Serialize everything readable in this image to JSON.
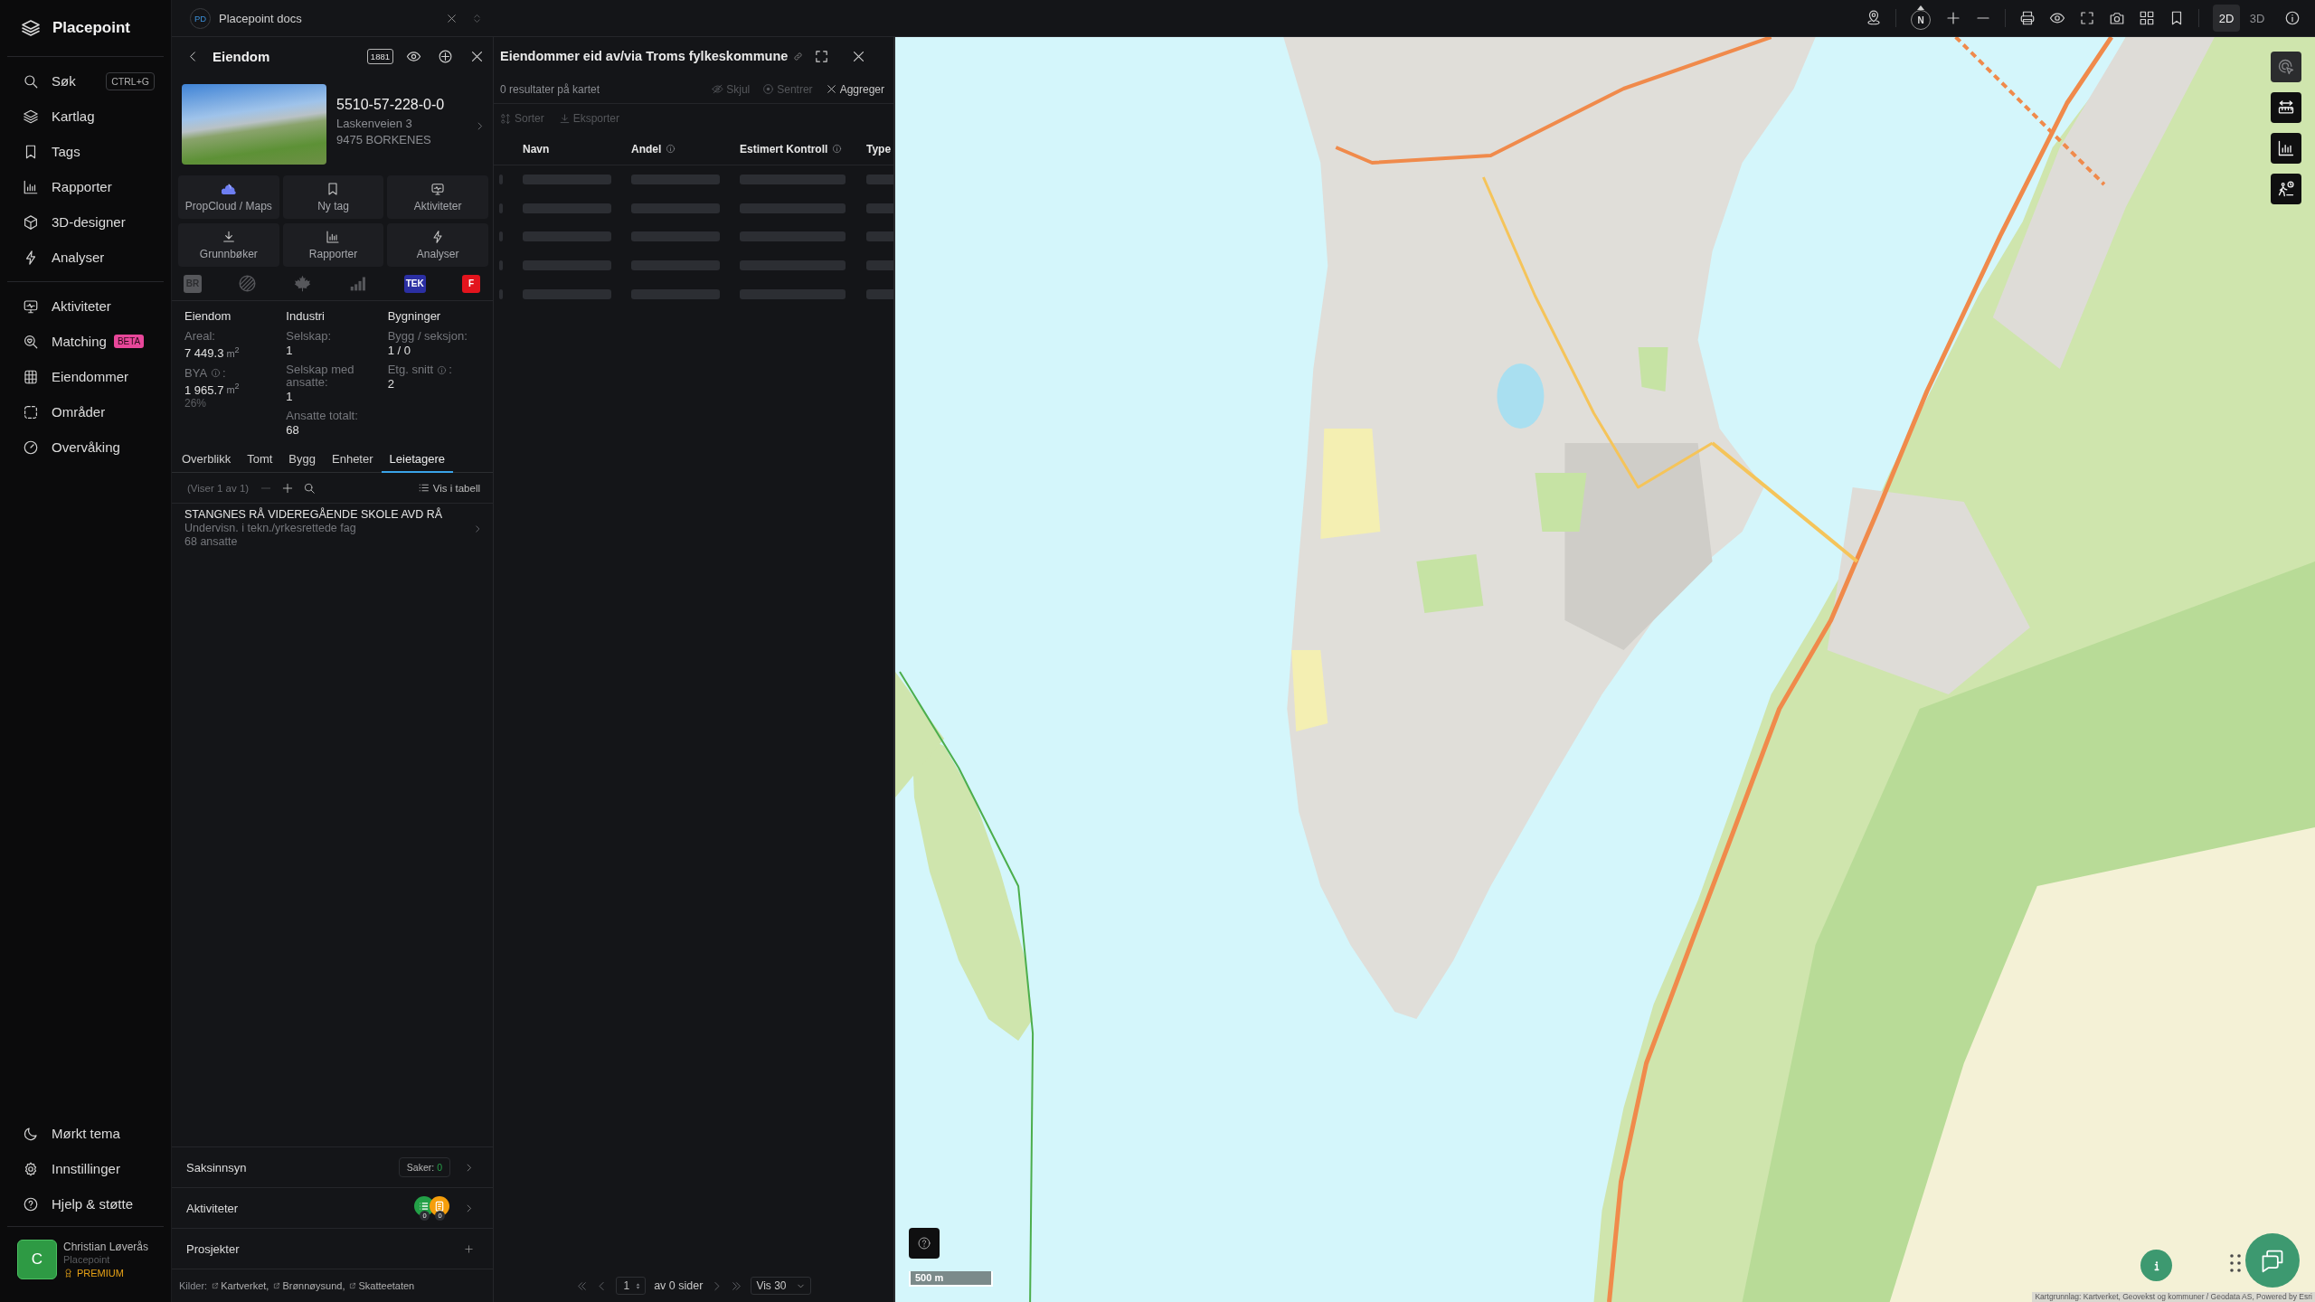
{
  "sidebar": {
    "app_name": "Placepoint",
    "nav_groups": [
      {
        "items": [
          {
            "label": "Søk",
            "shortcut": "CTRL+G"
          },
          {
            "label": "Kartlag"
          },
          {
            "label": "Tags"
          },
          {
            "label": "Rapporter"
          },
          {
            "label": "3D-designer"
          },
          {
            "label": "Analyser"
          }
        ]
      },
      {
        "items": [
          {
            "label": "Aktiviteter"
          },
          {
            "label": "Matching",
            "badge": "BETA"
          },
          {
            "label": "Eiendommer"
          },
          {
            "label": "Områder"
          },
          {
            "label": "Overvåking"
          }
        ]
      }
    ],
    "bottom_items": [
      {
        "label": "Mørkt tema"
      },
      {
        "label": "Innstillinger"
      },
      {
        "label": "Hjelp & støtte"
      }
    ],
    "user": {
      "initial": "C",
      "name": "Christian Løverås",
      "organization": "Placepoint",
      "plan": "PREMIUM"
    }
  },
  "docs_tab": {
    "initials": "PD",
    "title": "Placepoint docs"
  },
  "property_panel": {
    "title": "Eiendom",
    "lookup_label": "1881",
    "id": "5510-57-228-0-0",
    "address_lines": [
      "Laskenveien 3",
      "9475 BORKENES"
    ],
    "actions": [
      {
        "label": "PropCloud / Maps"
      },
      {
        "label": "Ny tag"
      },
      {
        "label": "Aktiviteter"
      },
      {
        "label": "Grunnbøker"
      },
      {
        "label": "Rapporter"
      },
      {
        "label": "Analyser"
      }
    ],
    "sources": [
      {
        "kind": "badge",
        "text": "BR",
        "color": "#56575b",
        "disabled": true
      },
      {
        "kind": "icon",
        "disabled": true
      },
      {
        "kind": "icon",
        "disabled": true
      },
      {
        "kind": "icon",
        "disabled": true
      },
      {
        "kind": "badge",
        "text": "TEK",
        "color": "#2b2fa3",
        "disabled": false
      },
      {
        "kind": "badge",
        "text": "F",
        "color": "#e3141d",
        "disabled": false
      }
    ],
    "facts": [
      {
        "title": "Eiendom",
        "fields": [
          {
            "label": "Areal:",
            "info": false,
            "value": "7 449.3",
            "unit": "m$^{2}$"
          },
          {
            "label": "BYA",
            "info": true,
            "label_end": ":",
            "value": "1 965.7",
            "unit": "m$^{2}$",
            "note": "26%"
          }
        ]
      },
      {
        "title": "Industri",
        "fields": [
          {
            "label": "Selskap:",
            "info": false,
            "value": "1"
          },
          {
            "label": "Selskap med ansatte:",
            "info": false,
            "value": "1"
          },
          {
            "label": "Ansatte totalt:",
            "info": false,
            "value": "68"
          }
        ]
      },
      {
        "title": "Bygninger",
        "fields": [
          {
            "label": "Bygg / seksjon:",
            "info": false,
            "value": "1 / 0"
          },
          {
            "label": "Etg. snitt",
            "info": true,
            "label_end": ":",
            "value": "2"
          }
        ]
      }
    ],
    "tabs": [
      {
        "label": "Overblikk",
        "selected": false
      },
      {
        "label": "Tomt",
        "selected": false
      },
      {
        "label": "Bygg",
        "selected": false
      },
      {
        "label": "Enheter",
        "selected": false
      },
      {
        "label": "Leietagere",
        "selected": true
      }
    ],
    "tenants": {
      "count_text": "(Viser 1 av 1)",
      "tools": [
        {
          "disabled": true
        },
        {
          "disabled": false
        },
        {
          "disabled": false
        }
      ],
      "table_view": "Vis i tabell",
      "items": [
        {
          "name": "STANGNES RÅ VIDEREGÅENDE SKOLE AVD RÅ",
          "industry": "Undervisn. i tekn./yrkesrettede fag",
          "employees": "68 ansatte"
        }
      ]
    },
    "sections": [
      {
        "kind": "cases",
        "label": "Saksinnsyn",
        "badge_label": "Saker:",
        "badge_value": "0"
      },
      {
        "kind": "activities",
        "label": "Aktiviteter",
        "counts": [
          {
            "count": "0",
            "color": "#23a047"
          },
          {
            "count": "0",
            "color": "#f59e0b"
          }
        ]
      },
      {
        "kind": "projects",
        "label": "Prosjekter"
      }
    ],
    "sources_footer": {
      "label": "Kilder:",
      "links": [
        "Kartverket,",
        "Brønnøysund,",
        "Skatteetaten"
      ]
    }
  },
  "results_panel": {
    "title": "Eiendommer eid av/via Troms fylkeskommune",
    "result_count": "0 resultater på kartet",
    "actions": [
      {
        "label": "Skjul",
        "disabled": true
      },
      {
        "label": "Sentrer",
        "disabled": true
      },
      {
        "label": "Aggreger",
        "disabled": false
      }
    ],
    "tools": [
      {
        "label": "Sorter",
        "disabled": true
      },
      {
        "label": "Eksporter",
        "disabled": true
      }
    ],
    "table": {
      "columns": [
        {
          "label": "Navn",
          "info": false
        },
        {
          "label": "Andel",
          "info": true
        },
        {
          "label": "Estimert Kontroll",
          "info": true
        },
        {
          "label": "Type",
          "info": false
        }
      ],
      "loading": true
    },
    "pagination": {
      "page": "1",
      "page_total": "av 0 sider",
      "page_size": "Vis 30"
    }
  },
  "map": {
    "toolbar": {
      "compass": "N",
      "view_modes": [
        {
          "label": "2D",
          "selected": true
        },
        {
          "label": "3D",
          "selected": false
        }
      ]
    },
    "side_tools": [
      {
        "disabled": true
      },
      {
        "disabled": false
      },
      {
        "disabled": false
      },
      {
        "disabled": false
      }
    ],
    "scale": "500 m",
    "attribution": "Kartgrunnlag: Kartverket, Geovekst og kommuner / Geodata AS, Powered by Esri"
  }
}
